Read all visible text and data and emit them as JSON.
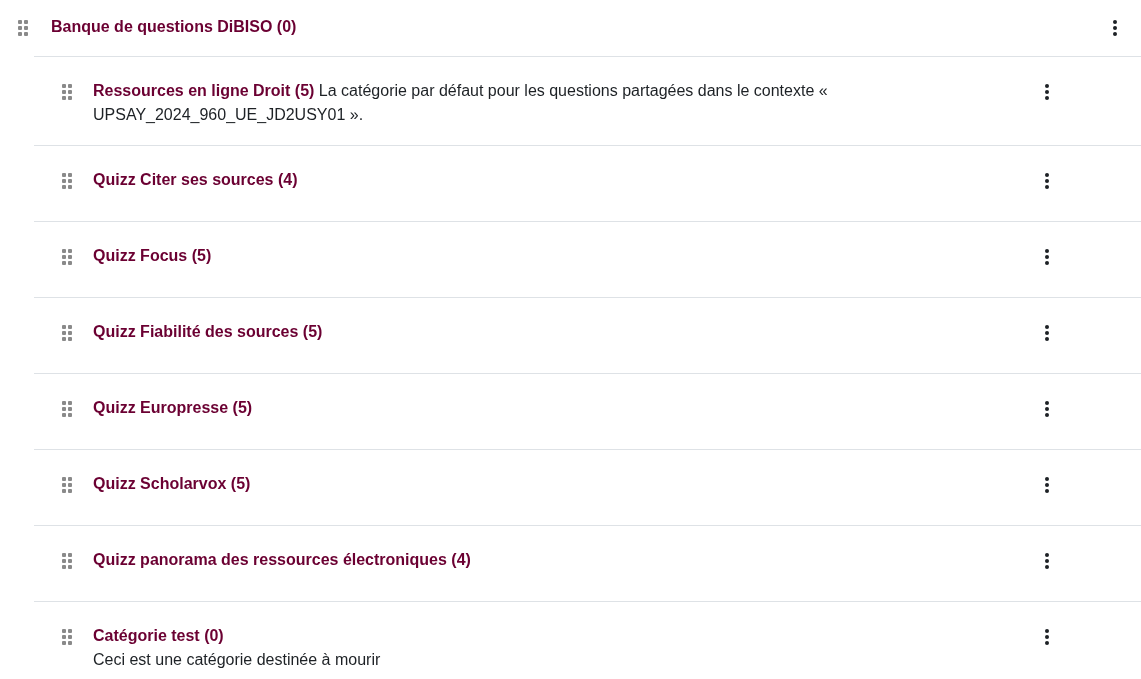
{
  "root": {
    "title": "Banque de questions DiBISO (0)"
  },
  "categories": [
    {
      "title": "Ressources en ligne Droit (5)",
      "kind": "inline",
      "description": "La catégorie par défaut pour les questions partagées dans le contexte « UPSAY_2024_960_UE_JD2USY01 »."
    },
    {
      "title": "Quizz Citer ses sources (4)",
      "kind": "plain"
    },
    {
      "title": "Quizz Focus (5)",
      "kind": "plain"
    },
    {
      "title": "Quizz Fiabilité des sources (5)",
      "kind": "plain"
    },
    {
      "title": "Quizz Europresse (5)",
      "kind": "plain"
    },
    {
      "title": "Quizz Scholarvox (5)",
      "kind": "plain"
    },
    {
      "title": "Quizz panorama des ressources électroniques (4)",
      "kind": "plain"
    },
    {
      "title": "Catégorie test (0)",
      "kind": "block",
      "description": "Ceci est une catégorie destinée à mourir"
    }
  ]
}
